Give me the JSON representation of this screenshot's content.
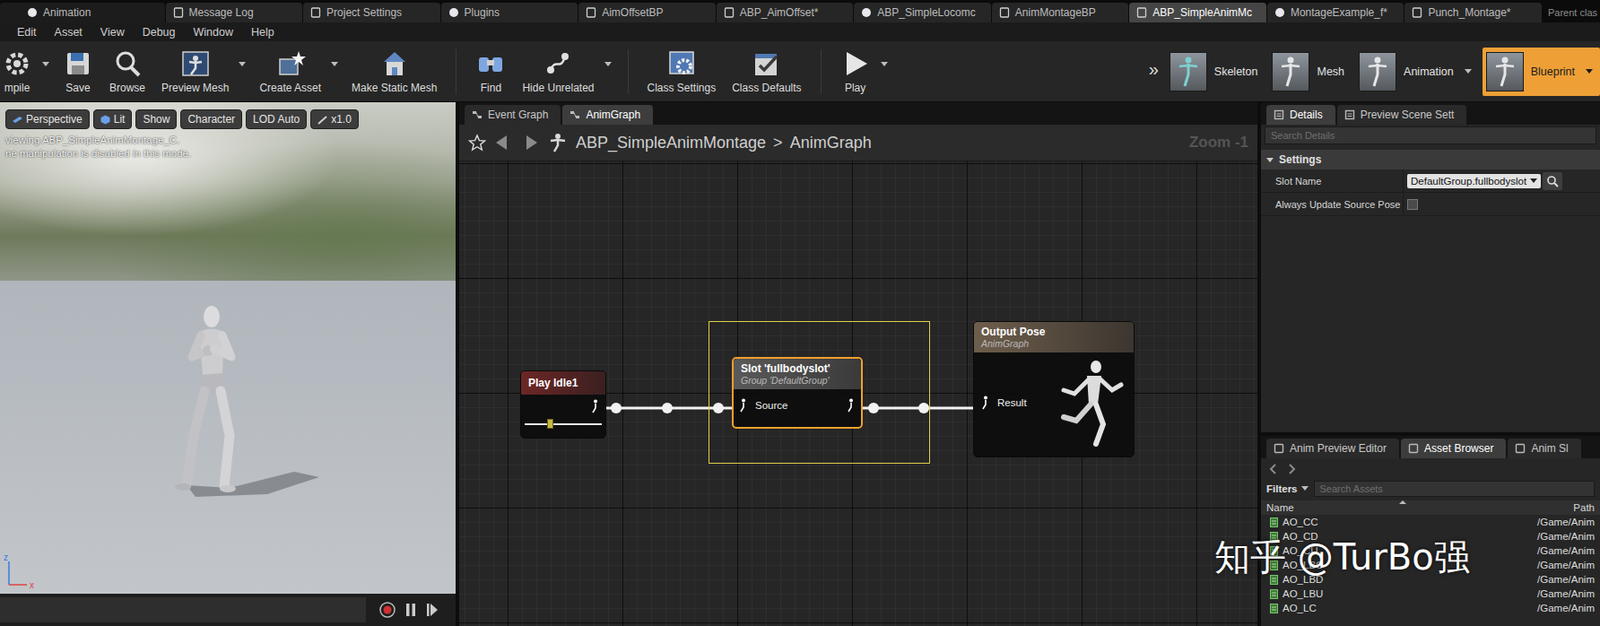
{
  "doc_tabs": [
    {
      "label": "Animation",
      "selected": false
    },
    {
      "label": "Message Log",
      "selected": false
    },
    {
      "label": "Project Settings",
      "selected": false
    },
    {
      "label": "Plugins",
      "selected": false
    },
    {
      "label": "AimOffsetBP",
      "selected": false
    },
    {
      "label": "ABP_AimOffset*",
      "selected": false
    },
    {
      "label": "ABP_SimpleLocomc",
      "selected": false
    },
    {
      "label": "AnimMontageBP",
      "selected": false
    },
    {
      "label": "ABP_SimpleAnimMc",
      "selected": true
    },
    {
      "label": "MontageExample_f*",
      "selected": false
    },
    {
      "label": "Punch_Montage*",
      "selected": false
    }
  ],
  "parent_class": "Parent clas",
  "menu": [
    "Edit",
    "Asset",
    "View",
    "Debug",
    "Window",
    "Help"
  ],
  "toolbar": [
    {
      "label": "mpile",
      "dropdown": true
    },
    {
      "label": "Save",
      "dropdown": false
    },
    {
      "label": "Browse",
      "dropdown": false
    },
    {
      "label": "Preview Mesh",
      "dropdown": true
    },
    {
      "label": "Create Asset",
      "dropdown": true
    },
    {
      "label": "Make Static Mesh",
      "dropdown": false
    },
    {
      "label": "Find",
      "dropdown": false
    },
    {
      "label": "Hide Unrelated",
      "dropdown": true
    },
    {
      "label": "Class Settings",
      "dropdown": false
    },
    {
      "label": "Class Defaults",
      "dropdown": false
    },
    {
      "label": "Play",
      "dropdown": true
    }
  ],
  "toolbar_overflow": "»",
  "modes": [
    {
      "label": "Skeleton",
      "selected": false,
      "dropdown": false
    },
    {
      "label": "Mesh",
      "selected": false,
      "dropdown": false
    },
    {
      "label": "Animation",
      "selected": false,
      "dropdown": true
    },
    {
      "label": "Blueprint",
      "selected": true,
      "dropdown": true
    }
  ],
  "viewport": {
    "buttons": [
      "Perspective",
      "Lit",
      "Show",
      "Character",
      "LOD Auto",
      "x1.0"
    ],
    "messages": [
      "viewing ABP_SimpleAnimMontage_C.",
      "ne manipulation is disabled in this mode."
    ],
    "axes": [
      "z",
      "x"
    ]
  },
  "graph": {
    "tabs": [
      {
        "label": "Event Graph",
        "selected": false
      },
      {
        "label": "AnimGraph",
        "selected": true
      }
    ],
    "breadcrumb": [
      "ABP_SimpleAnimMontage",
      "AnimGraph"
    ],
    "separator": ">",
    "zoom": "Zoom -1",
    "play_node": {
      "title": "Play Idle1",
      "level": 0.33
    },
    "slot_node": {
      "title": "Slot 'fullbodyslot'",
      "subtitle": "Group 'DefaultGroup'",
      "pin": "Source",
      "selected": true
    },
    "output_node": {
      "title": "Output Pose",
      "subtitle": "AnimGraph",
      "pin": "Result"
    }
  },
  "details": {
    "tabs": [
      {
        "label": "Details",
        "selected": true
      },
      {
        "label": "Preview Scene Sett",
        "selected": false
      }
    ],
    "search_placeholder": "Search Details",
    "section": "Settings",
    "expanded": true,
    "slot_label": "Slot Name",
    "slot_value": "DefaultGroup.fullbodyslot",
    "update_label": "Always Update Source Pose",
    "update_checked": false
  },
  "assets": {
    "tabs": [
      {
        "label": "Anim Preview Editor",
        "selected": false
      },
      {
        "label": "Asset Browser",
        "selected": true
      },
      {
        "label": "Anim Sl",
        "selected": false
      }
    ],
    "filters": "Filters",
    "search_placeholder": "Search Assets",
    "columns": [
      "Name",
      "Path"
    ],
    "rows": [
      {
        "name": "AO_CC",
        "path": "/Game/Anim"
      },
      {
        "name": "AO_CD",
        "path": "/Game/Anim"
      },
      {
        "name": "AO_CU",
        "path": "/Game/Anim"
      },
      {
        "name": "AO_LBC",
        "path": "/Game/Anim"
      },
      {
        "name": "AO_LBD",
        "path": "/Game/Anim"
      },
      {
        "name": "AO_LBU",
        "path": "/Game/Anim"
      },
      {
        "name": "AO_LC",
        "path": "/Game/Anim"
      }
    ]
  },
  "watermark": "知乎 @TurBo强"
}
